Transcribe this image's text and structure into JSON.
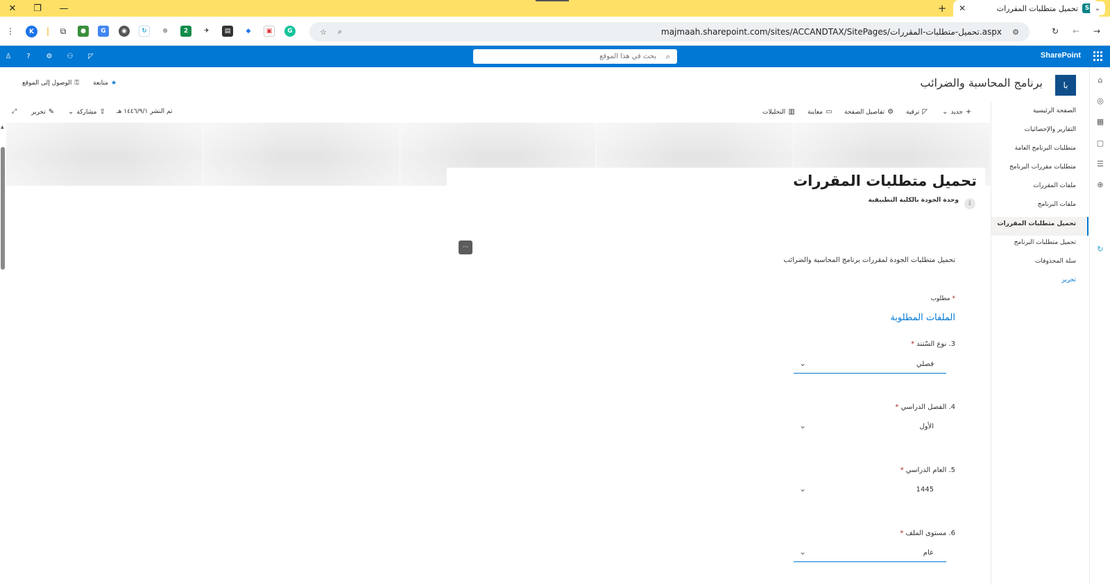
{
  "browser": {
    "tab_title": "تحميل متطلبات المقررات",
    "tab_favicon_letter": "S",
    "profile_letter": "K",
    "extension_badge": "2",
    "url": "majmaah.sharepoint.com/sites/ACCANDTAX/SitePages/تحميل-متطلبات-المقررات.aspx"
  },
  "suitebar": {
    "brand": "SharePoint",
    "search_placeholder": "بحث في هذا الموقع",
    "color": "#0078d4"
  },
  "site": {
    "logo_text": "با",
    "title": "برنامج المحاسبة والضرائب",
    "follow": "متابعة",
    "site_access": "الوصول إلى الموقع"
  },
  "nav": {
    "items": [
      {
        "label": "الصفحة الرئيسية"
      },
      {
        "label": "التقارير والإحصائيات"
      },
      {
        "label": "متطلبات البرنامج العامة"
      },
      {
        "label": "متطلبات مقررات البرنامج"
      },
      {
        "label": "ملفات المقررات"
      },
      {
        "label": "ملفات البرنامج"
      },
      {
        "label": "تحميل متطلبات المقررات"
      },
      {
        "label": "تحميل متطلبات البرنامج"
      },
      {
        "label": "سلة المحذوفات"
      }
    ],
    "selected_index": 6,
    "edit": "تحرير"
  },
  "commandbar": {
    "new": "جديد",
    "promote": "ترقية",
    "page_details": "تفاصيل الصفحة",
    "preview": "معاينة",
    "analytics": "التحليلات",
    "published": "تم النشر ١٤٤٦/٩/١ هـ",
    "share": "مشاركة",
    "edit": "تحرير"
  },
  "page": {
    "title": "تحميل متطلبات المقررات",
    "author": "وحدة الجودة بالكلية التطبيقية",
    "intro": "تحميل متطلبات الجودة  لمقررات برنامج المحاسبة والضرائب",
    "more_label": "···"
  },
  "form": {
    "required_note": "مطلوب",
    "required_star": "*",
    "section_title": "الملفات المطلوبة",
    "fields": [
      {
        "label": "3. نوع السّتند",
        "value": "فصلي"
      },
      {
        "label": "4. الفصل الدراسي",
        "value": "الأول"
      },
      {
        "label": "5. العام الدراسي",
        "value": "1445"
      },
      {
        "label": "6. مستوى الملف",
        "value": "عام"
      }
    ]
  }
}
